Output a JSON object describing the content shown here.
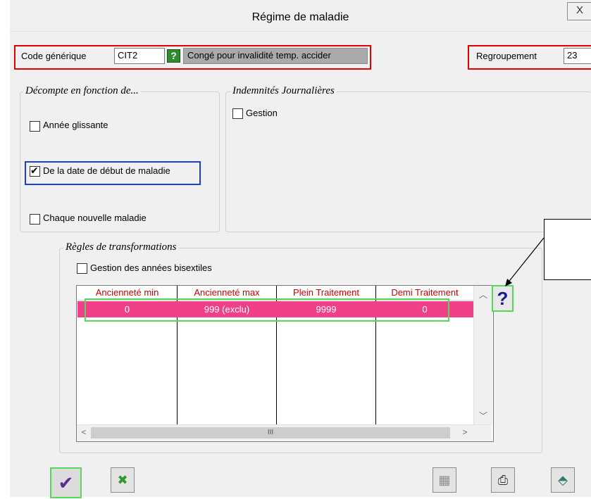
{
  "window": {
    "title": "Régime de maladie",
    "close_label": "X"
  },
  "header": {
    "code_label": "Code générique",
    "code_value": "CIT2",
    "help_label": "?",
    "code_desc": "Congé pour invalidité temp. accider",
    "regroupement_label": "Regroupement",
    "regroupement_value": "23"
  },
  "decompte": {
    "title": "Décompte en fonction de...",
    "options": [
      {
        "label": "Année glissante",
        "checked": false
      },
      {
        "label": "De la date de début de maladie",
        "checked": true
      },
      {
        "label": "Chaque nouvelle maladie",
        "checked": false
      }
    ]
  },
  "indemnites": {
    "title": "Indemnités Journalières",
    "gestion_label": "Gestion",
    "gestion_checked": false
  },
  "regles": {
    "title": "Règles de transformations",
    "bisextiles_label": "Gestion des années bisextiles",
    "bisextiles_checked": false,
    "columns": [
      "Ancienneté min",
      "Ancienneté max",
      "Plein Traitement",
      "Demi Traitement"
    ],
    "rows": [
      [
        "0",
        "999 (exclu)",
        "9999",
        "0"
      ]
    ],
    "hscroll_thumb_label": "III",
    "help_label": "?"
  },
  "colors": {
    "selected_row": "#f0408a",
    "header_text": "#cc0000",
    "highlight_red": "#e00000",
    "highlight_green": "#5ad65a",
    "highlight_blue": "#1e3cd6"
  },
  "toolbar": {
    "validate_icon": "checkmark-icon",
    "cancel_icon": "cancel-x-icon",
    "grid_icon": "grid-icon",
    "print_icon": "printer-icon",
    "exit_icon": "exit-icon"
  }
}
